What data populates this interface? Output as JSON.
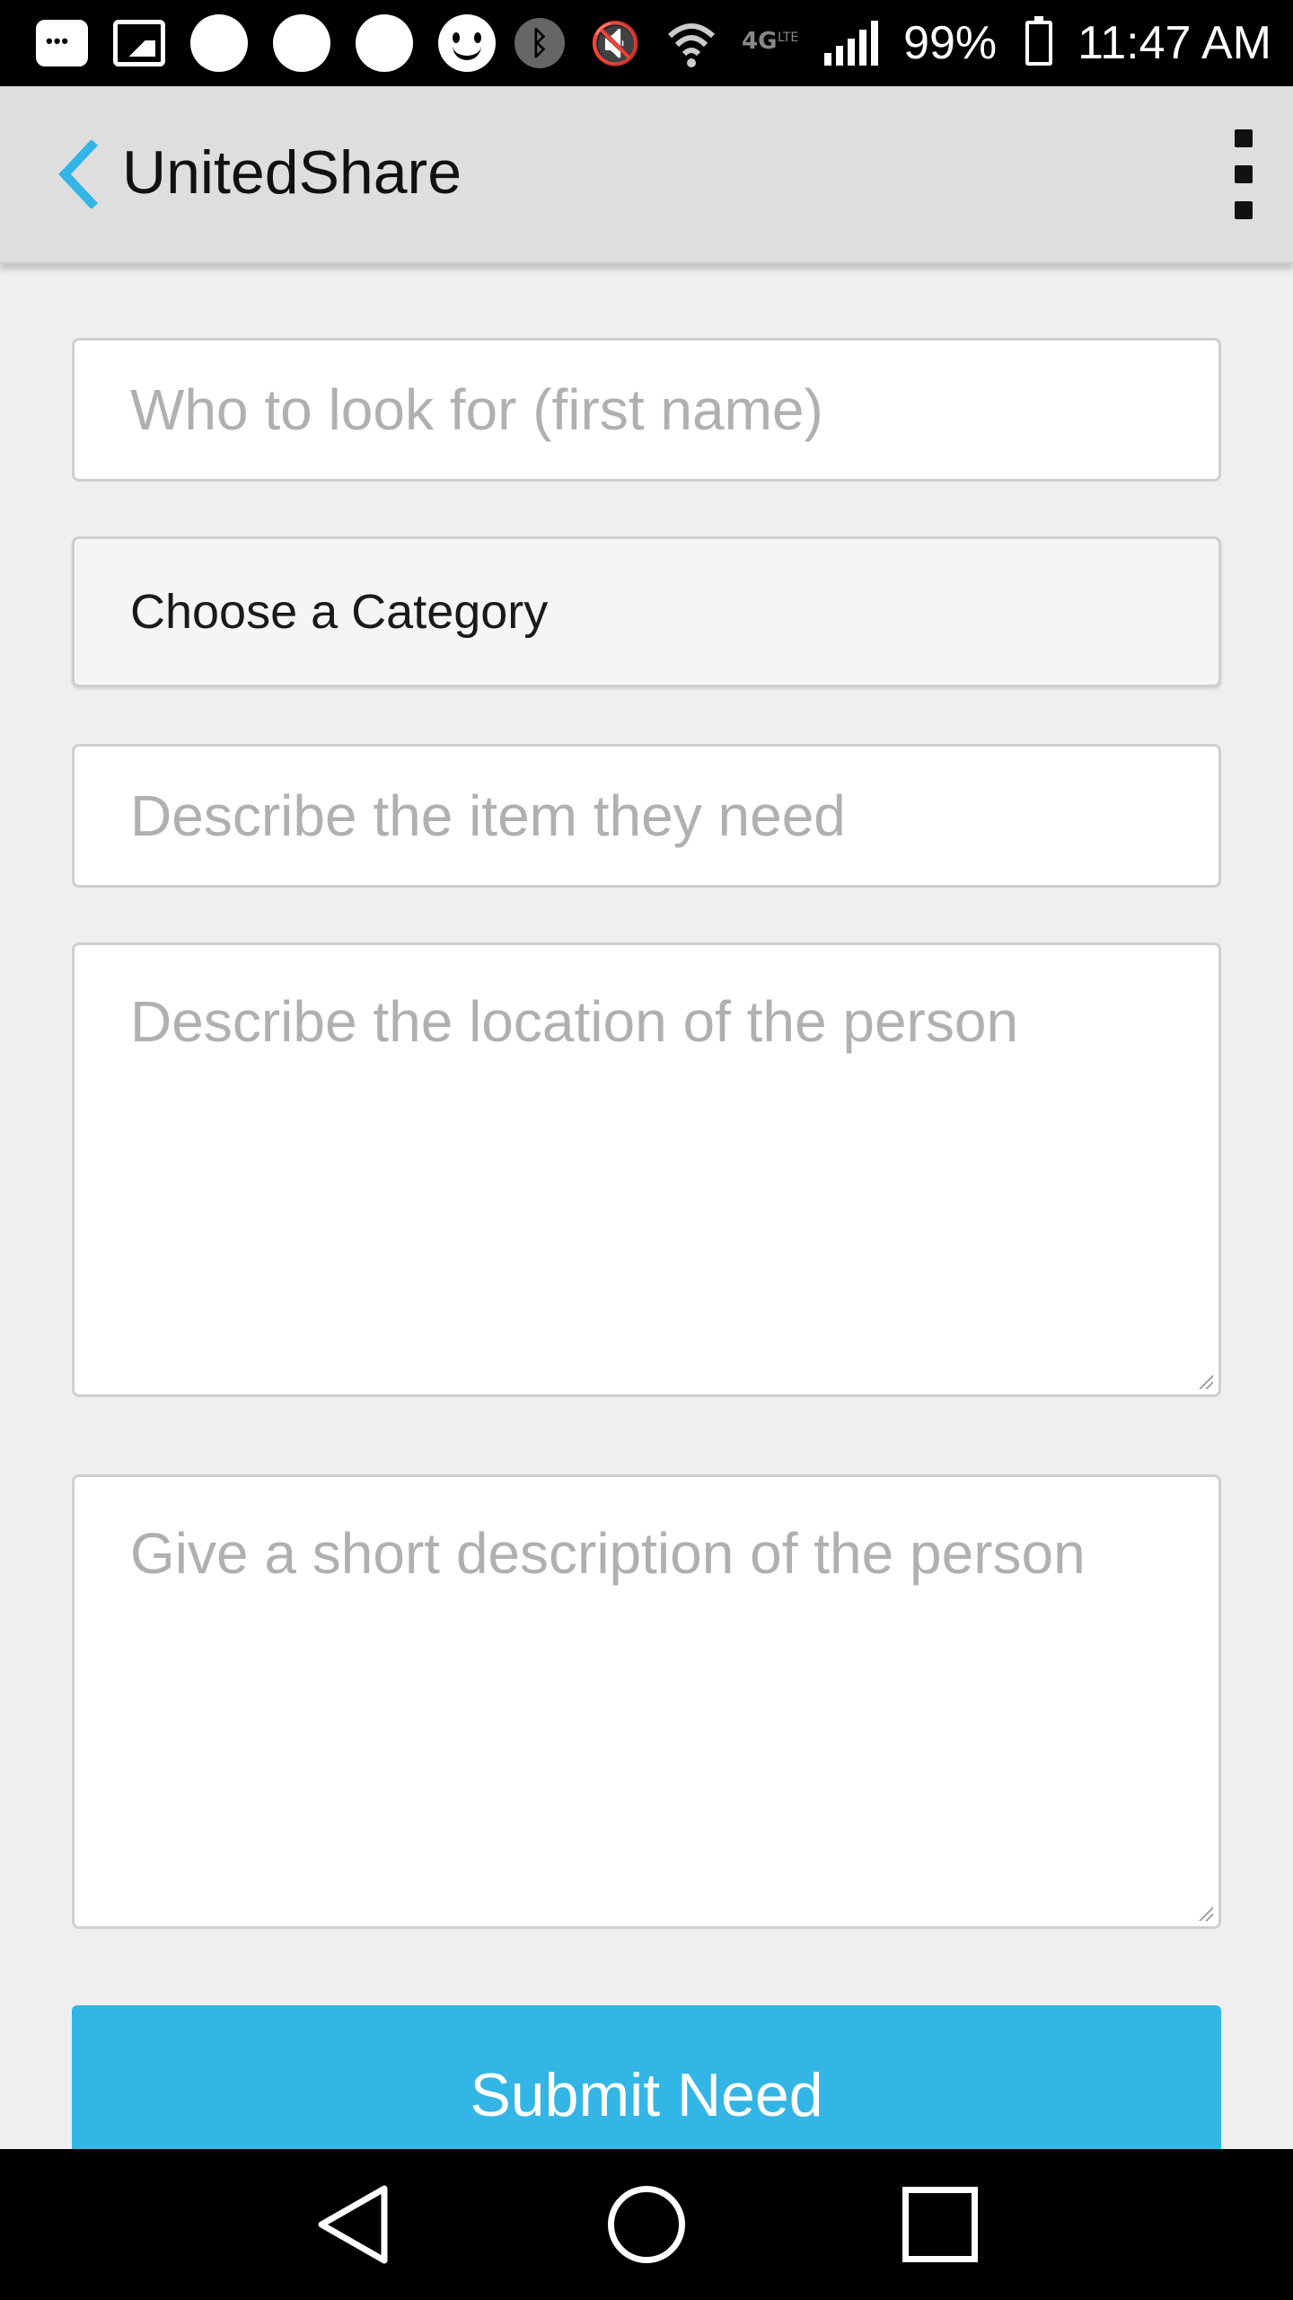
{
  "status_bar": {
    "battery_percent": "99%",
    "time": "11:47 AM",
    "icons": [
      "message-icon",
      "image-icon",
      "circle-notification-icon",
      "circle-notification-icon",
      "circle-notification-icon",
      "smiley-icon",
      "bluetooth-icon",
      "mute-icon",
      "wifi-icon",
      "4g-icon",
      "signal-icon",
      "battery-icon"
    ]
  },
  "app_bar": {
    "title": "UnitedShare",
    "back_color": "#33b5e5"
  },
  "form": {
    "first_name": {
      "placeholder": "Who to look for (first name)",
      "value": ""
    },
    "category": {
      "selected": "Choose a Category"
    },
    "item": {
      "placeholder": "Describe the item they need",
      "value": ""
    },
    "location": {
      "placeholder": "Describe the location of the person",
      "value": ""
    },
    "description": {
      "placeholder": "Give a short description of the person",
      "value": ""
    },
    "submit_label": "Submit Need",
    "accent_color": "#33b5e5"
  },
  "nav_bar": {
    "icons": [
      "back-nav-icon",
      "home-nav-icon",
      "recent-apps-icon"
    ]
  }
}
